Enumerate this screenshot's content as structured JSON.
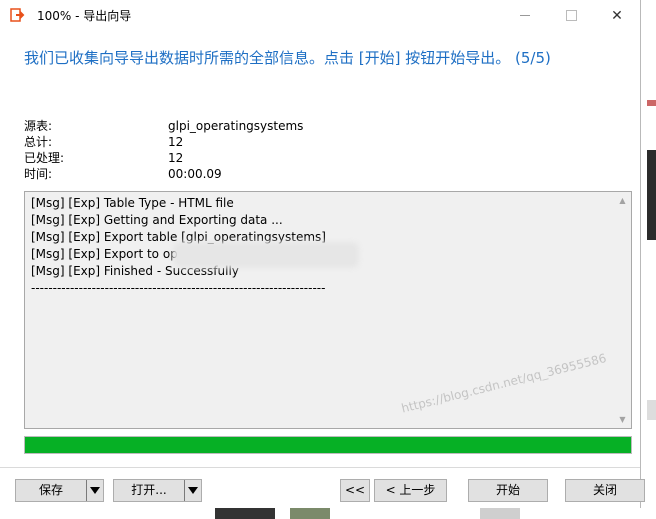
{
  "window": {
    "title": "100% - 导出向导",
    "minimize_icon": "minimize-icon",
    "maximize_icon": "maximize-icon",
    "close_icon": "close-icon",
    "close_glyph": "✕"
  },
  "heading": "我们已收集向导导出数据时所需的全部信息。点击 [开始] 按钮开始导出。 (5/5)",
  "info": [
    {
      "label": "源表:",
      "value": "glpi_operatingsystems"
    },
    {
      "label": "总计:",
      "value": "12"
    },
    {
      "label": "已处理:",
      "value": "12"
    },
    {
      "label": "时间:",
      "value": "00:00.09"
    }
  ],
  "log": {
    "lines": [
      "[Msg] [Exp] Table Type - HTML file",
      "[Msg] [Exp] Getting and Exporting data ...",
      "[Msg] [Exp] Export table [glpi_operatingsystems]",
      "[Msg] [Exp] Export to                                                    operatingsystems.html",
      "[Msg] [Exp] Finished - Successfully",
      "--------------------------------------------------------------------"
    ]
  },
  "progress": {
    "fraction": 1.0,
    "color": "#06b025"
  },
  "buttons": {
    "save": "保存",
    "open": "打开...",
    "back_first": "<<",
    "prev": "< 上一步",
    "start": "开始",
    "close": "关闭"
  },
  "watermark": "https://blog.csdn.net/qq_36955586",
  "colors": {
    "heading": "#1e6fc4",
    "accent_icon": "#e8501a"
  }
}
